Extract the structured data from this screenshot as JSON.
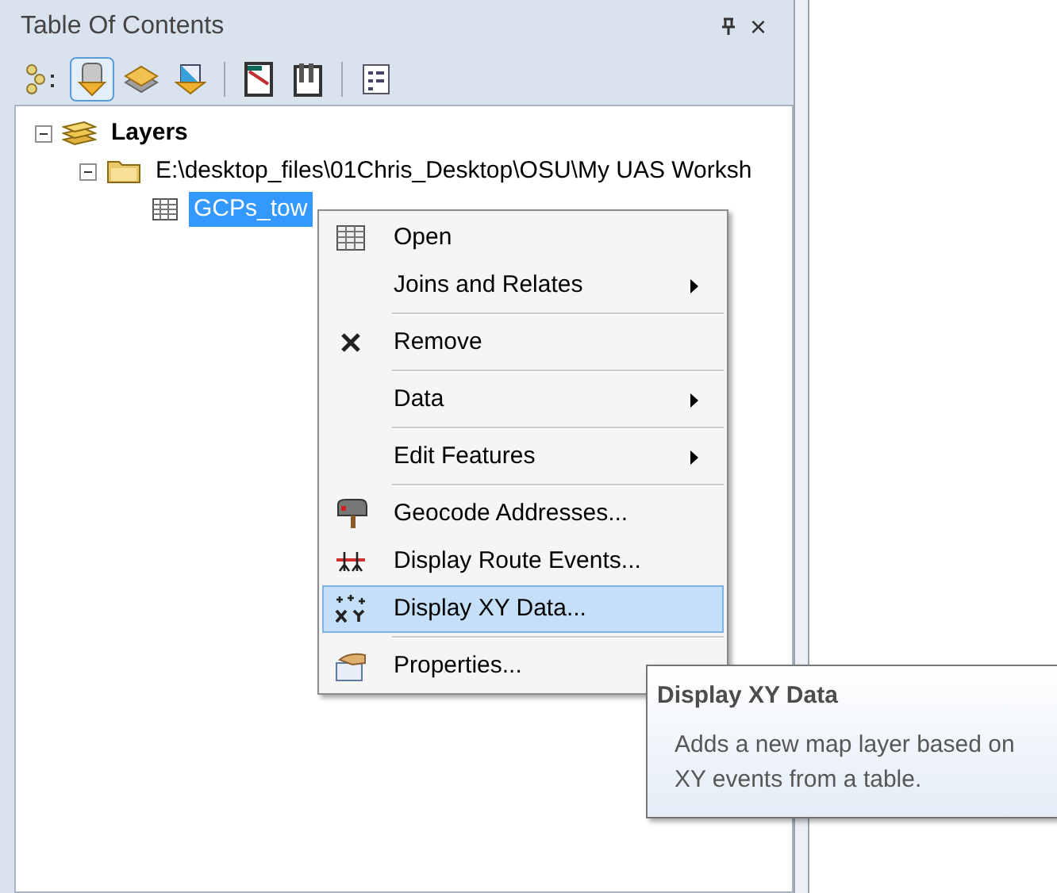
{
  "panel": {
    "title": "Table Of Contents",
    "close": "×"
  },
  "toolbar": [
    {
      "kind": "list",
      "selected": false
    },
    {
      "kind": "source",
      "selected": true
    },
    {
      "kind": "display",
      "selected": false
    },
    {
      "kind": "selection",
      "selected": false
    },
    {
      "kind": "sep"
    },
    {
      "kind": "options",
      "selected": false
    },
    {
      "kind": "tools",
      "selected": false
    },
    {
      "kind": "sep"
    },
    {
      "kind": "properties",
      "selected": false
    }
  ],
  "tree": [
    {
      "label": "Layers",
      "kind": "frame",
      "expanded": true,
      "children": [
        {
          "label": "E:\\desktop_files\\01Chris_Desktop\\OSU\\My UAS Worksh",
          "kind": "folder",
          "expanded": true,
          "children": [
            {
              "label": "GCPs_tow",
              "kind": "table",
              "selected": true
            }
          ]
        }
      ]
    }
  ],
  "context_menu": [
    {
      "label": "Open",
      "kind": "table",
      "submenu": false,
      "selected": false,
      "separator_after": false
    },
    {
      "label": "Joins and Relates",
      "kind": "plain",
      "submenu": true,
      "selected": false,
      "separator_after": true
    },
    {
      "label": "Remove",
      "kind": "remove",
      "submenu": false,
      "selected": false,
      "separator_after": true
    },
    {
      "label": "Data",
      "kind": "plain",
      "submenu": true,
      "selected": false,
      "separator_after": true
    },
    {
      "label": "Edit Features",
      "kind": "plain",
      "submenu": true,
      "selected": false,
      "separator_after": true
    },
    {
      "label": "Geocode Addresses...",
      "kind": "geocode",
      "submenu": false,
      "selected": false,
      "separator_after": false
    },
    {
      "label": "Display Route Events...",
      "kind": "route",
      "submenu": false,
      "selected": false,
      "separator_after": false
    },
    {
      "label": "Display XY Data...",
      "kind": "xy",
      "submenu": false,
      "selected": true,
      "separator_after": true
    },
    {
      "label": "Properties...",
      "kind": "properties",
      "submenu": false,
      "selected": false,
      "separator_after": false
    }
  ],
  "tooltip": {
    "title": "Display XY Data",
    "text": "Adds a new map layer based on XY events from a table."
  }
}
